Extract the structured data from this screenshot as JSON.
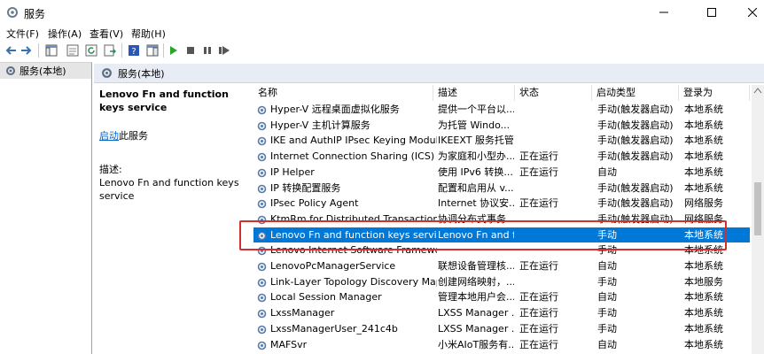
{
  "window": {
    "title": "服务"
  },
  "menu": [
    "文件(F)",
    "操作(A)",
    "查看(V)",
    "帮助(H)"
  ],
  "tree": {
    "root_label": "服务(本地)"
  },
  "panel": {
    "header": "服务(本地)"
  },
  "details": {
    "service_name": "Lenovo Fn and function keys service",
    "start_link": "启动",
    "start_suffix": "此服务",
    "desc_label": "描述:",
    "desc_text": "Lenovo Fn and function keys service"
  },
  "columns": [
    "名称",
    "描述",
    "状态",
    "启动类型",
    "登录为"
  ],
  "rows": [
    [
      "Hyper-V 远程桌面虚拟化服务",
      "提供一个平台以...",
      "",
      "手动(触发器启动)",
      "本地系统"
    ],
    [
      "Hyper-V 主机计算服务",
      "为托管 Windo...",
      "",
      "手动(触发器启动)",
      "本地系统"
    ],
    [
      "IKE and AuthIP IPsec Keying Modules",
      "IKEEXT 服务托管...",
      "",
      "手动(触发器启动)",
      "本地系统"
    ],
    [
      "Internet Connection Sharing (ICS)",
      "为家庭和小型办...",
      "正在运行",
      "手动(触发器启动)",
      "本地系统"
    ],
    [
      "IP Helper",
      "使用 IPv6 转换...",
      "正在运行",
      "自动",
      "本地系统"
    ],
    [
      "IP 转换配置服务",
      "配置和启用从 v...",
      "",
      "手动(触发器启动)",
      "本地系统"
    ],
    [
      "IPsec Policy Agent",
      "Internet 协议安...",
      "正在运行",
      "手动(触发器启动)",
      "网络服务"
    ],
    [
      "KtmRm for Distributed Transaction Co...",
      "协调分布式事务...",
      "",
      "手动(触发器启动)",
      "网络服务"
    ],
    [
      "Lenovo Fn and function keys service",
      "Lenovo Fn and f...",
      "",
      "手动",
      "本地系统"
    ],
    [
      "Lenovo Internet Software Framework",
      "",
      "",
      "手动",
      "本地系统"
    ],
    [
      "LenovoPcManagerService",
      "联想设备管理核...",
      "正在运行",
      "自动",
      "本地系统"
    ],
    [
      "Link-Layer Topology Discovery Mapper",
      "创建网络映射，...",
      "",
      "手动",
      "本地服务"
    ],
    [
      "Local Session Manager",
      "管理本地用户会...",
      "正在运行",
      "自动",
      "本地系统"
    ],
    [
      "LxssManager",
      "LXSS Manager ...",
      "正在运行",
      "手动",
      "本地系统"
    ],
    [
      "LxssManagerUser_241c4b",
      "LXSS Manager ...",
      "正在运行",
      "手动",
      "本地系统"
    ],
    [
      "MAFSvr",
      "小米AIoT服务有...",
      "正在运行",
      "自动",
      "本地系统"
    ]
  ],
  "selected_row_index": 8,
  "colors": {
    "selection": "#0078d7",
    "highlight_box": "#d32f2f"
  }
}
